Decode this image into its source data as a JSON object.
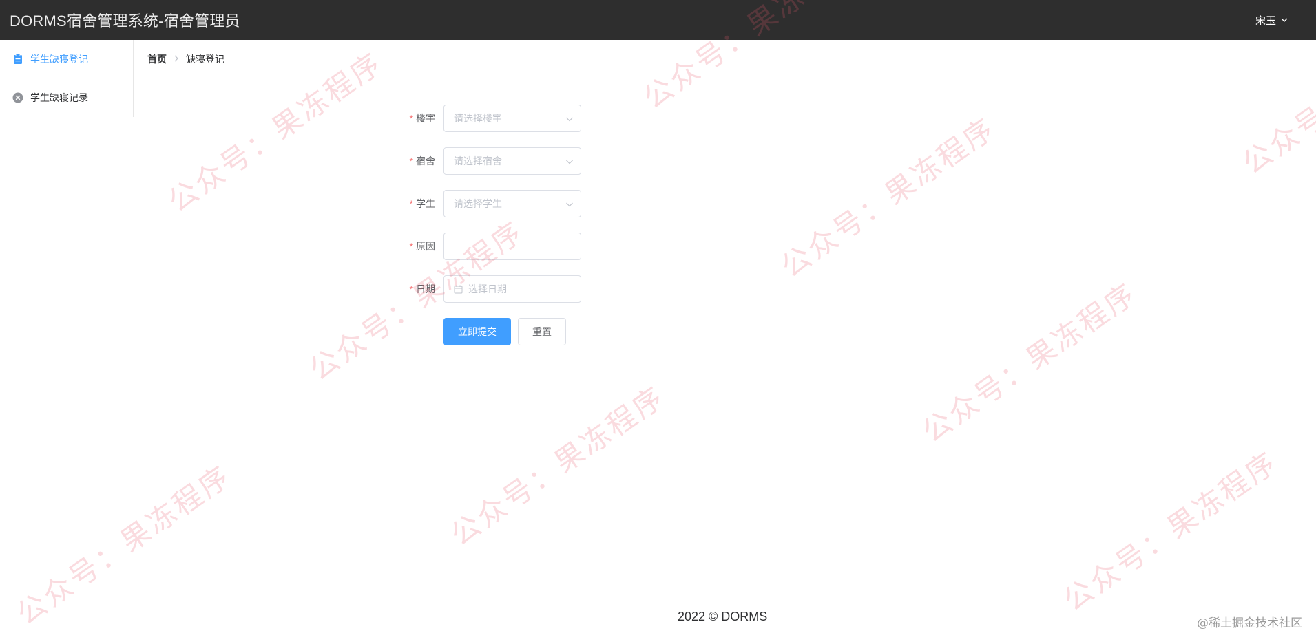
{
  "header": {
    "title": "DORMS宿舍管理系统-宿舍管理员",
    "user_name": "宋玉"
  },
  "sidebar": {
    "items": [
      {
        "label": "学生缺寝登记",
        "icon": "clipboard-icon",
        "active": true
      },
      {
        "label": "学生缺寝记录",
        "icon": "circle-close-icon",
        "active": false
      }
    ]
  },
  "breadcrumb": {
    "home": "首页",
    "current": "缺寝登记"
  },
  "form": {
    "building": {
      "label": "楼宇",
      "placeholder": "请选择楼宇"
    },
    "dorm": {
      "label": "宿舍",
      "placeholder": "请选择宿舍"
    },
    "student": {
      "label": "学生",
      "placeholder": "请选择学生"
    },
    "reason": {
      "label": "原因",
      "value": ""
    },
    "date": {
      "label": "日期",
      "placeholder": "选择日期"
    },
    "submit_label": "立即提交",
    "reset_label": "重置"
  },
  "footer": {
    "copyright": "2022 © DORMS"
  },
  "watermark": {
    "text": "公众号：果冻程序"
  },
  "site_mark": "@稀土掘金技术社区",
  "colors": {
    "header_bg": "#2e2e2e",
    "accent": "#409eff",
    "required": "#f56c6c"
  }
}
